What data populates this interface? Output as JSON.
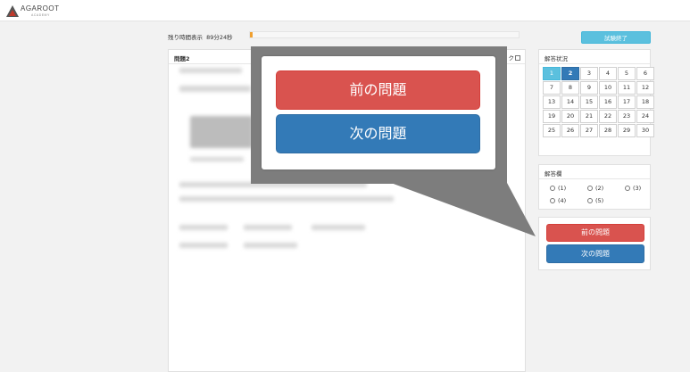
{
  "header": {
    "logo_text": "AGAROOT",
    "logo_sub": "ACADEMY"
  },
  "timer": {
    "label": "残り時間表示",
    "remaining": "89分24秒",
    "progress_fraction": 0.01
  },
  "end_button": "試験終了",
  "question": {
    "title": "問題2",
    "flag_label": "ク"
  },
  "status_panel": {
    "title": "解答状況",
    "cells": [
      "1",
      "2",
      "3",
      "4",
      "5",
      "6",
      "7",
      "8",
      "9",
      "10",
      "11",
      "12",
      "13",
      "14",
      "15",
      "16",
      "17",
      "18",
      "19",
      "20",
      "21",
      "22",
      "23",
      "24",
      "25",
      "26",
      "27",
      "28",
      "29",
      "30"
    ],
    "answered": [
      "1"
    ],
    "current": "2"
  },
  "answer_panel": {
    "title": "解答欄",
    "options": [
      "(1)",
      "(2)",
      "(3)",
      "(4)",
      "(5)"
    ]
  },
  "nav": {
    "prev_label": "前の問題",
    "next_label": "次の問題"
  },
  "colors": {
    "prev": "#d9534f",
    "next": "#337ab7",
    "answered": "#5bc0de",
    "timer": "#f0a030",
    "callout": "#7d7d7d"
  }
}
